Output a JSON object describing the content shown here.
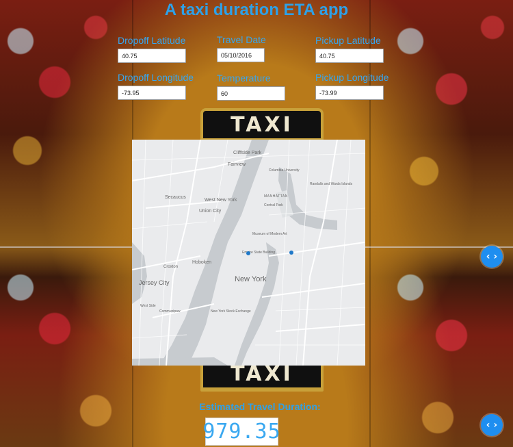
{
  "app": {
    "title": "A taxi duration ETA app"
  },
  "background": {
    "sign_text": "TAXI"
  },
  "form": {
    "dropoff_latitude": {
      "label": "Dropoff Latitude",
      "value": "40.75"
    },
    "dropoff_longitude": {
      "label": "Dropoff Longitude",
      "value": "-73.95"
    },
    "travel_date": {
      "label": "Travel Date",
      "value": "05/10/2016"
    },
    "temperature": {
      "label": "Temperature",
      "value": "60"
    },
    "pickup_latitude": {
      "label": "Pickup Latitude",
      "value": "40.75"
    },
    "pickup_longitude": {
      "label": "Pickup Longitude",
      "value": "-73.99"
    }
  },
  "map": {
    "labels": {
      "cliffside_park": "Cliffside Park",
      "fairview": "Fairview",
      "columbia": "Columbia University",
      "secaucus": "Secaucus",
      "west_new_york": "West New York",
      "manhattan": "MANHATTAN",
      "central_park": "Central Park",
      "randalls": "Randalls and Wards Islands",
      "union_city": "Union City",
      "museum": "Museum of Modern Art",
      "empire": "Empire State Building",
      "hoboken": "Hoboken",
      "croxton": "Croxton",
      "jersey_city": "Jersey City",
      "new_york": "New York",
      "west_side": "West Side",
      "nyse": "New York Stock Exchange",
      "communipaw": "Communipaw"
    },
    "marker_colors": {
      "pickup": "#1f78c8",
      "dropoff": "#1f78c8"
    }
  },
  "nav": {
    "arrow_button_glyph": "‹ ›"
  },
  "result": {
    "label": "Estimated Travel Duration:",
    "value": "979.35"
  },
  "colors": {
    "accent": "#2ea1e8",
    "button": "#1e8ef0"
  }
}
